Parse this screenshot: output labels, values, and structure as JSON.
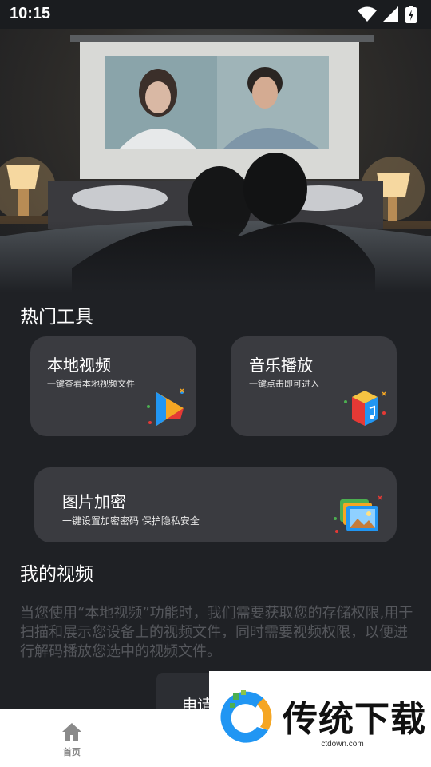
{
  "status_bar": {
    "time": "10:15"
  },
  "hot_tools": {
    "title": "热门工具",
    "cards": [
      {
        "title": "本地视频",
        "subtitle": "一键查看本地视频文件",
        "icon": "play-icon"
      },
      {
        "title": "音乐播放",
        "subtitle": "一键点击即可进入",
        "icon": "music-cube-icon"
      },
      {
        "title": "图片加密",
        "subtitle": "一键设置加密密码  保护隐私安全",
        "icon": "image-stack-icon"
      }
    ]
  },
  "my_videos": {
    "title": "我的视频",
    "permission_text": "当您使用“本地视频”功能时，我们需要获取您的存储权限,用于扫描和展示您设备上的视频文件，同时需要视频权限，以便进行解码播放您选中的视频文件。",
    "apply_button": "申请"
  },
  "bottom_nav": {
    "home_label": "首页"
  },
  "watermark": {
    "brand": "传统下载",
    "url": "ctdown.com"
  },
  "colors": {
    "background": "#1f2125",
    "card": "#3a3b40",
    "accent_blue": "#2196f3",
    "accent_orange": "#f5a623"
  }
}
